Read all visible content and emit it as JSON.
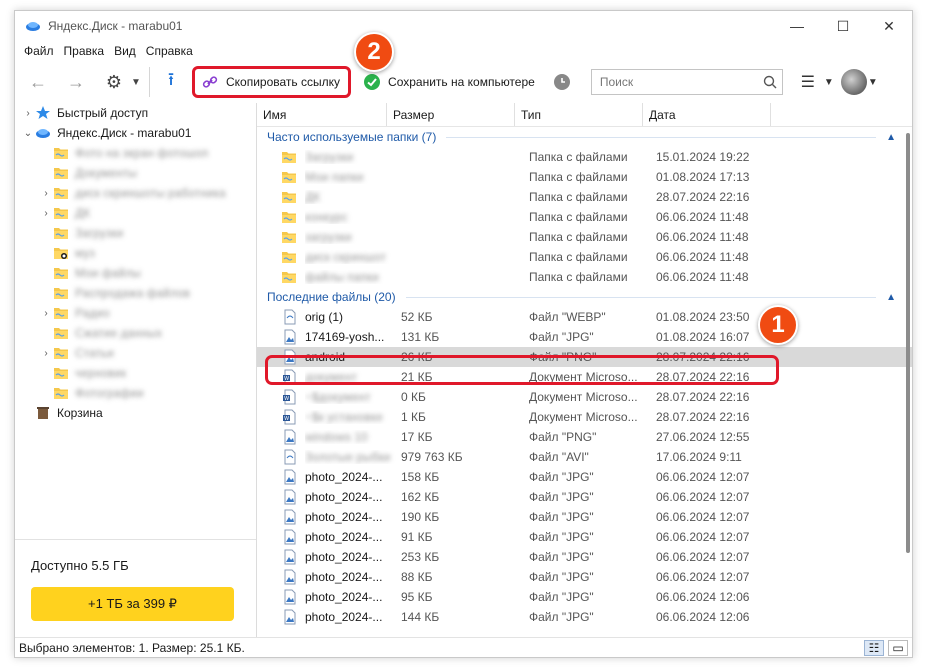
{
  "window": {
    "title": "Яндекс.Диск - marabu01"
  },
  "menu": [
    "Файл",
    "Правка",
    "Вид",
    "Справка"
  ],
  "toolbar": {
    "copy_link": "Скопировать ссылку",
    "save_to_pc": "Сохранить на компьютере",
    "search_placeholder": "Поиск"
  },
  "tree": [
    {
      "label": "Быстрый доступ",
      "arrow": "›",
      "icon": "star",
      "level": 0
    },
    {
      "label": "Яндекс.Диск - marabu01",
      "arrow": "⌄",
      "icon": "disk",
      "level": 0
    },
    {
      "label": "Фото на экран фотошоп",
      "arrow": "",
      "icon": "folder",
      "level": 1,
      "blur": true
    },
    {
      "label": "Документы",
      "arrow": "",
      "icon": "folder",
      "level": 1,
      "blur": true
    },
    {
      "label": "диск скриншоты работника",
      "arrow": "›",
      "icon": "folder",
      "level": 1,
      "blur": true
    },
    {
      "label": "ДК",
      "arrow": "›",
      "icon": "folder",
      "level": 1,
      "blur": true
    },
    {
      "label": "Загрузки",
      "arrow": "",
      "icon": "folder",
      "level": 1,
      "blur": true
    },
    {
      "label": "муз",
      "arrow": "",
      "icon": "folder-shared",
      "level": 1,
      "blur": true
    },
    {
      "label": "Мои файлы",
      "arrow": "",
      "icon": "folder",
      "level": 1,
      "blur": true
    },
    {
      "label": "Распродажа файлов",
      "arrow": "",
      "icon": "folder",
      "level": 1,
      "blur": true
    },
    {
      "label": "Радио",
      "arrow": "›",
      "icon": "folder",
      "level": 1,
      "blur": true
    },
    {
      "label": "Сжатие данных",
      "arrow": "",
      "icon": "folder",
      "level": 1,
      "blur": true
    },
    {
      "label": "Статьи",
      "arrow": "›",
      "icon": "folder",
      "level": 1,
      "blur": true
    },
    {
      "label": "черновик",
      "arrow": "",
      "icon": "folder",
      "level": 1,
      "blur": true
    },
    {
      "label": "Фотографии",
      "arrow": "",
      "icon": "folder",
      "level": 1,
      "blur": true
    },
    {
      "label": "Корзина",
      "arrow": "",
      "icon": "trash",
      "level": 0
    }
  ],
  "storage": {
    "available": "Доступно 5.5 ГБ",
    "buy": "+1 ТБ за 399 ₽"
  },
  "columns": [
    "Имя",
    "Размер",
    "Тип",
    "Дата"
  ],
  "groups": {
    "frequent": "Часто используемые папки (7)",
    "recent": "Последние файлы (20)"
  },
  "folders": [
    {
      "name": "Загрузки",
      "type": "Папка с файлами",
      "date": "15.01.2024 19:22"
    },
    {
      "name": "Мои папки",
      "type": "Папка с файлами",
      "date": "01.08.2024 17:13"
    },
    {
      "name": "ДК",
      "type": "Папка с файлами",
      "date": "28.07.2024 22:16"
    },
    {
      "name": "конкурс",
      "type": "Папка с файлами",
      "date": "06.06.2024 11:48"
    },
    {
      "name": "загрузки",
      "type": "Папка с файлами",
      "date": "06.06.2024 11:48"
    },
    {
      "name": "диск скриншот",
      "type": "Папка с файлами",
      "date": "06.06.2024 11:48"
    },
    {
      "name": "файлы папки",
      "type": "Папка с файлами",
      "date": "06.06.2024 11:48"
    }
  ],
  "files": [
    {
      "name": "orig (1)",
      "size": "52 КБ",
      "type": "Файл \"WEBP\"",
      "date": "01.08.2024 23:50",
      "icon": "file",
      "blur": false
    },
    {
      "name": "174169-yosh...",
      "size": "131 КБ",
      "type": "Файл \"JPG\"",
      "date": "01.08.2024 16:07",
      "icon": "img",
      "blur": false
    },
    {
      "name": "android",
      "size": "26 КБ",
      "type": "Файл \"PNG\"",
      "date": "28.07.2024 22:16",
      "icon": "img",
      "blur": false,
      "selected": true
    },
    {
      "name": "документ",
      "size": "21 КБ",
      "type": "Документ Microso...",
      "date": "28.07.2024 22:16",
      "icon": "doc",
      "blur": true
    },
    {
      "name": "~$документ",
      "size": "0 КБ",
      "type": "Документ Microso...",
      "date": "28.07.2024 22:16",
      "icon": "doc",
      "blur": true
    },
    {
      "name": "~$к установке",
      "size": "1 КБ",
      "type": "Документ Microso...",
      "date": "28.07.2024 22:16",
      "icon": "doc",
      "blur": true
    },
    {
      "name": "windows 10",
      "size": "17 КБ",
      "type": "Файл \"PNG\"",
      "date": "27.06.2024 12:55",
      "icon": "img",
      "blur": true
    },
    {
      "name": "Золотые рыбки",
      "size": "979 763 КБ",
      "type": "Файл \"AVI\"",
      "date": "17.06.2024 9:11",
      "icon": "file",
      "blur": true
    },
    {
      "name": "photo_2024-...",
      "size": "158 КБ",
      "type": "Файл \"JPG\"",
      "date": "06.06.2024 12:07",
      "icon": "img",
      "blur": false
    },
    {
      "name": "photo_2024-...",
      "size": "162 КБ",
      "type": "Файл \"JPG\"",
      "date": "06.06.2024 12:07",
      "icon": "img",
      "blur": false
    },
    {
      "name": "photo_2024-...",
      "size": "190 КБ",
      "type": "Файл \"JPG\"",
      "date": "06.06.2024 12:07",
      "icon": "img",
      "blur": false
    },
    {
      "name": "photo_2024-...",
      "size": "91 КБ",
      "type": "Файл \"JPG\"",
      "date": "06.06.2024 12:07",
      "icon": "img",
      "blur": false
    },
    {
      "name": "photo_2024-...",
      "size": "253 КБ",
      "type": "Файл \"JPG\"",
      "date": "06.06.2024 12:07",
      "icon": "img",
      "blur": false
    },
    {
      "name": "photo_2024-...",
      "size": "88 КБ",
      "type": "Файл \"JPG\"",
      "date": "06.06.2024 12:07",
      "icon": "img",
      "blur": false
    },
    {
      "name": "photo_2024-...",
      "size": "95 КБ",
      "type": "Файл \"JPG\"",
      "date": "06.06.2024 12:06",
      "icon": "img",
      "blur": false
    },
    {
      "name": "photo_2024-...",
      "size": "144 КБ",
      "type": "Файл \"JPG\"",
      "date": "06.06.2024 12:06",
      "icon": "img",
      "blur": false
    }
  ],
  "status": {
    "text": "Выбрано элементов: 1. Размер: 25.1 КБ."
  },
  "badges": [
    "1",
    "2"
  ],
  "colors": {
    "accent": "#1f5aa8",
    "highlight": "#e0182a",
    "badge": "#f04b12",
    "buy": "#ffd21e"
  }
}
